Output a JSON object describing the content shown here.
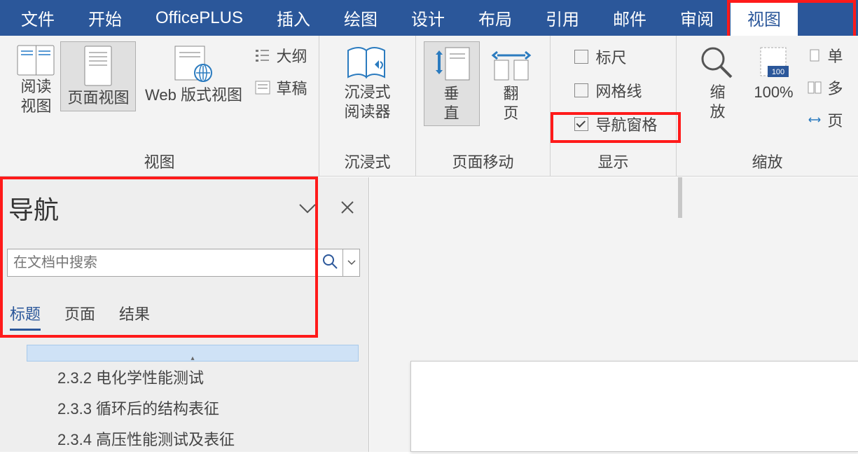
{
  "colors": {
    "brand": "#2b579a",
    "highlight": "#ff1a1a"
  },
  "menu": {
    "tabs": [
      "文件",
      "开始",
      "OfficePLUS",
      "插入",
      "绘图",
      "设计",
      "布局",
      "引用",
      "邮件",
      "审阅",
      "视图"
    ],
    "active_index": 10
  },
  "ribbon": {
    "views_group": {
      "label": "视图",
      "read_view": "阅读\n视图",
      "page_view": "页面视图",
      "web_view": "Web 版式视图",
      "outline": "大纲",
      "draft": "草稿"
    },
    "immersive_group": {
      "label": "沉浸式",
      "reader": "沉浸式\n阅读器"
    },
    "pagemove_group": {
      "label": "页面移动",
      "vertical": "垂\n直",
      "flip": "翻\n页"
    },
    "show_group": {
      "label": "显示",
      "ruler": "标尺",
      "grid": "网格线",
      "nav": "导航窗格",
      "ruler_on": false,
      "grid_on": false,
      "nav_on": true
    },
    "zoom_group": {
      "label": "缩放",
      "zoom": "缩\n放",
      "z100": "100%",
      "single": "单",
      "multi": "多",
      "page": "页"
    }
  },
  "navpane": {
    "title": "导航",
    "search_placeholder": "在文档中搜索",
    "tabs": [
      "标题",
      "页面",
      "结果"
    ],
    "active_tab": 0,
    "items": [
      {
        "text": "▴",
        "class": "blue"
      },
      {
        "text": "2.3.2 电化学性能测试",
        "class": "child"
      },
      {
        "text": "2.3.3 循环后的结构表征",
        "class": "child"
      },
      {
        "text": "2.3.4 高压性能测试及表征",
        "class": "child"
      }
    ]
  }
}
